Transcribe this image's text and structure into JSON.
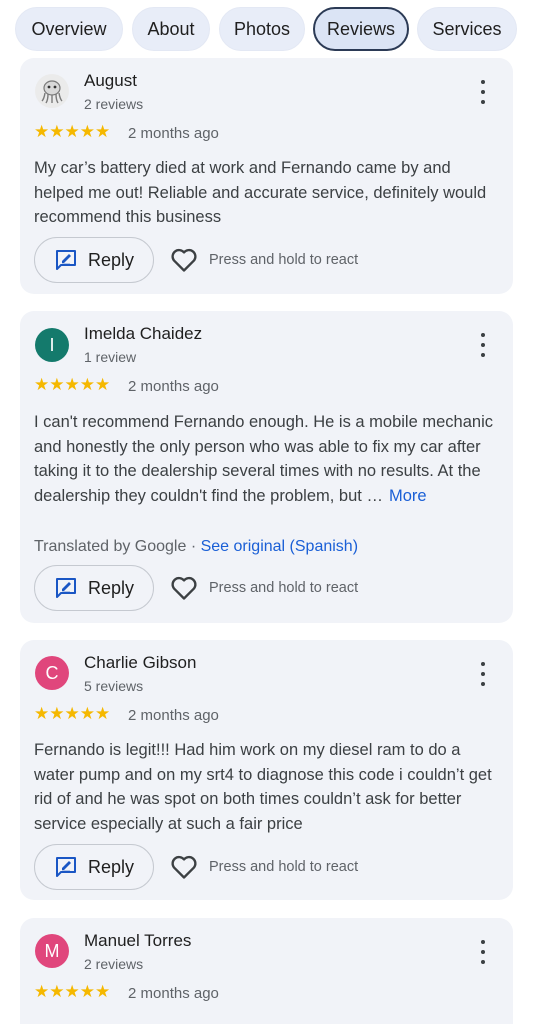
{
  "tabs": [
    {
      "label": "Overview"
    },
    {
      "label": "About"
    },
    {
      "label": "Photos"
    },
    {
      "label": "Reviews"
    },
    {
      "label": "Services"
    }
  ],
  "reviews": [
    {
      "name": "August",
      "count": "2 reviews",
      "avatar": "photo",
      "avatar_color": "#ebebeb",
      "stars": "★★★★★",
      "date": "2 months ago",
      "text": "My car’s battery died at work and Fernando came by and helped me out! Reliable and accurate service, definitely would recommend this business",
      "reply_label": "Reply",
      "react_label": "Press and hold to react"
    },
    {
      "name": "Imelda Chaidez",
      "count": "1 review",
      "avatar": "I",
      "avatar_color": "#147a6c",
      "stars": "★★★★★",
      "date": "2 months ago",
      "text": "I can't recommend Fernando enough. He is a mobile mechanic and honestly the only person who was able to fix my car after taking it to the dealership several times with no results. At the dealership they couldn't find the problem, but …",
      "more_label": "More",
      "translated_label": "Translated by Google · ",
      "see_original_label": "See original (Spanish)",
      "reply_label": "Reply",
      "react_label": "Press and hold to react"
    },
    {
      "name": "Charlie Gibson",
      "count": "5 reviews",
      "avatar": "C",
      "avatar_color": "#e0467c",
      "stars": "★★★★★",
      "date": "2 months ago",
      "text": "Fernando is legit!!! Had him work on my diesel ram to do a water pump and on my srt4 to diagnose this code i couldn’t get rid of and he was spot on both times couldn’t ask for better service especially at such a fair price",
      "reply_label": "Reply",
      "react_label": "Press and hold to react"
    },
    {
      "name": "Manuel Torres",
      "count": "2 reviews",
      "avatar": "M",
      "avatar_color": "#e0467c",
      "stars": "★★★★★",
      "date": "2 months ago"
    }
  ],
  "icons": {
    "reply": "reply-edit-icon",
    "react": "heart-outline-icon",
    "menu": "more-vert-icon"
  },
  "colors": {
    "card_bg": "#f1f3f8",
    "star": "#f5b800",
    "link": "#1a5fd6",
    "active_tab_border": "#2b3a55"
  }
}
